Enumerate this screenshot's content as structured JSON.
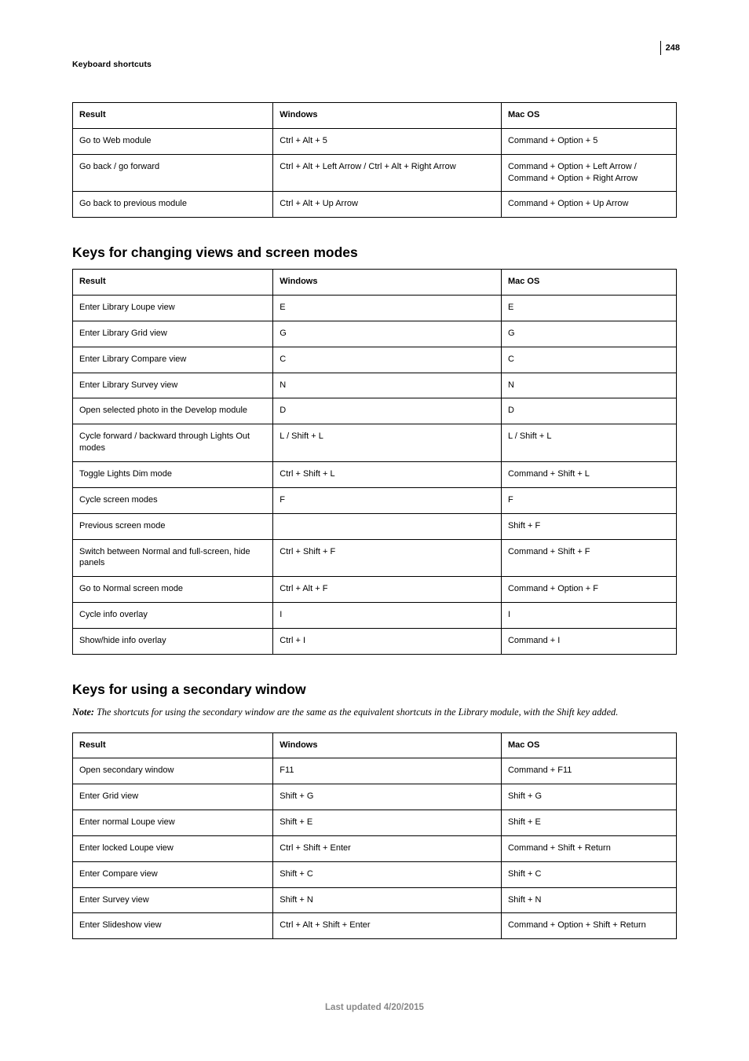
{
  "page_number": "248",
  "section_label": "Keyboard shortcuts",
  "footer": "Last updated 4/20/2015",
  "tables": {
    "top": {
      "headers": {
        "c1": "Result",
        "c2": "Windows",
        "c3": "Mac OS"
      },
      "rows": [
        {
          "c1": "Go to Web module",
          "c2": "Ctrl + Alt + 5",
          "c3": "Command + Option + 5"
        },
        {
          "c1": "Go back / go forward",
          "c2": "Ctrl + Alt + Left Arrow / Ctrl + Alt + Right Arrow",
          "c3": "Command + Option + Left Arrow / Command + Option + Right Arrow"
        },
        {
          "c1": "Go back to previous module",
          "c2": "Ctrl + Alt + Up Arrow",
          "c3": "Command + Option + Up Arrow"
        }
      ]
    },
    "views": {
      "title": "Keys for changing views and screen modes",
      "headers": {
        "c1": "Result",
        "c2": "Windows",
        "c3": "Mac OS"
      },
      "rows": [
        {
          "c1": "Enter Library Loupe view",
          "c2": "E",
          "c3": "E"
        },
        {
          "c1": "Enter Library Grid view",
          "c2": "G",
          "c3": "G"
        },
        {
          "c1": "Enter Library Compare view",
          "c2": "C",
          "c3": "C"
        },
        {
          "c1": "Enter Library Survey view",
          "c2": "N",
          "c3": "N"
        },
        {
          "c1": "Open selected photo in the Develop module",
          "c2": "D",
          "c3": "D"
        },
        {
          "c1": "Cycle forward / backward through Lights Out modes",
          "c2": "L / Shift + L",
          "c3": "L / Shift + L"
        },
        {
          "c1": "Toggle Lights Dim mode",
          "c2": "Ctrl + Shift + L",
          "c3": "Command + Shift + L"
        },
        {
          "c1": "Cycle screen modes",
          "c2": "F",
          "c3": "F"
        },
        {
          "c1": "Previous screen mode",
          "c2": "",
          "c3": "Shift + F"
        },
        {
          "c1": "Switch between Normal and full-screen, hide panels",
          "c2": "Ctrl + Shift + F",
          "c3": "Command + Shift + F"
        },
        {
          "c1": "Go to Normal screen mode",
          "c2": "Ctrl + Alt + F",
          "c3": "Command + Option + F"
        },
        {
          "c1": "Cycle info overlay",
          "c2": "I",
          "c3": "I"
        },
        {
          "c1": "Show/hide info overlay",
          "c2": "Ctrl + I",
          "c3": "Command + I"
        }
      ]
    },
    "secondary": {
      "title": "Keys for using a secondary window",
      "note_label": "Note:",
      "note_body": " The shortcuts for using the secondary window are the same as the equivalent shortcuts in the Library module, with the Shift key added.",
      "headers": {
        "c1": "Result",
        "c2": "Windows",
        "c3": "Mac OS"
      },
      "rows": [
        {
          "c1": "Open secondary window",
          "c2": "F11",
          "c3": "Command + F11"
        },
        {
          "c1": "Enter Grid view",
          "c2": "Shift + G",
          "c3": "Shift + G"
        },
        {
          "c1": "Enter normal Loupe view",
          "c2": "Shift + E",
          "c3": "Shift + E"
        },
        {
          "c1": "Enter locked Loupe view",
          "c2": "Ctrl + Shift + Enter",
          "c3": "Command + Shift + Return"
        },
        {
          "c1": "Enter Compare view",
          "c2": "Shift + C",
          "c3": "Shift + C"
        },
        {
          "c1": "Enter Survey view",
          "c2": "Shift + N",
          "c3": "Shift + N"
        },
        {
          "c1": "Enter Slideshow view",
          "c2": "Ctrl + Alt + Shift + Enter",
          "c3": "Command + Option + Shift + Return"
        }
      ]
    }
  }
}
